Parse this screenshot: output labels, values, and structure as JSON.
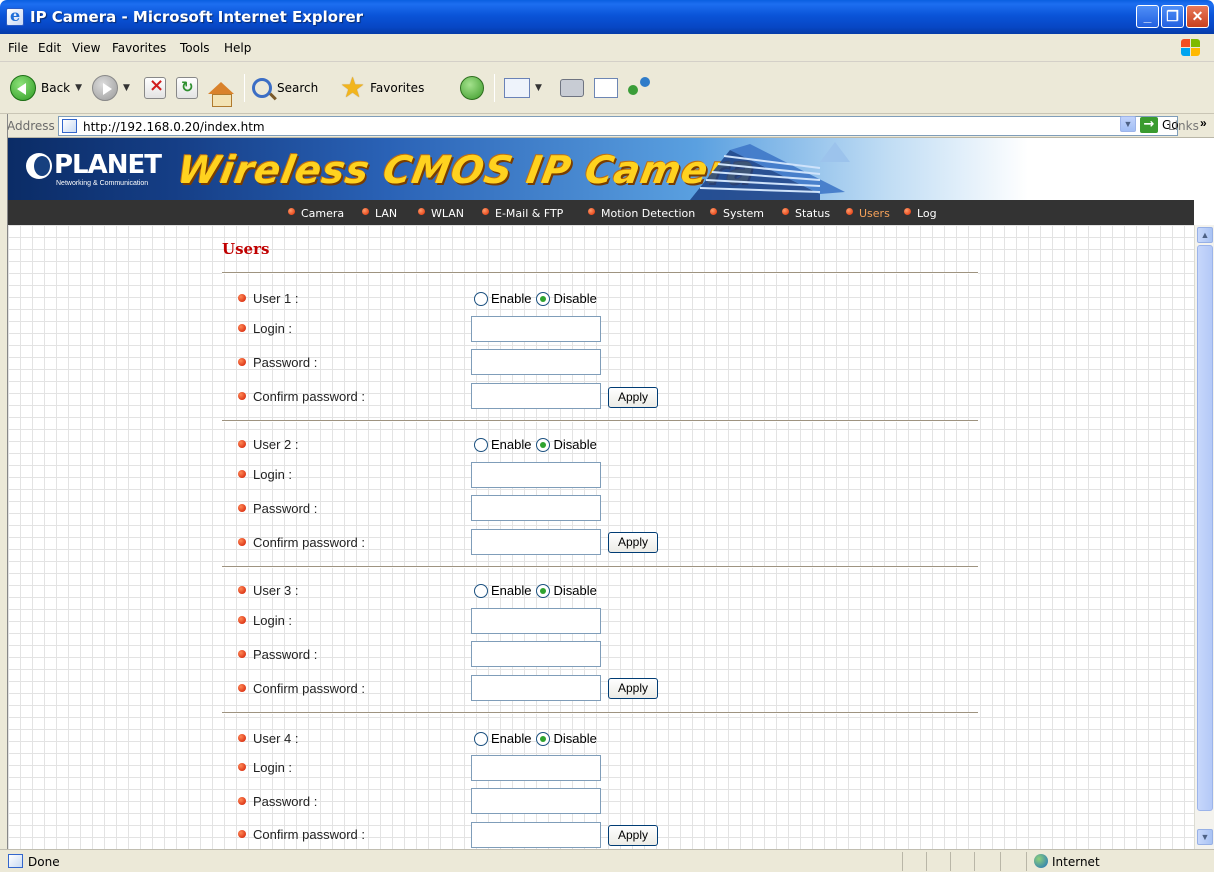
{
  "window": {
    "title": "IP Camera - Microsoft Internet Explorer"
  },
  "menu": [
    "File",
    "Edit",
    "View",
    "Favorites",
    "Tools",
    "Help"
  ],
  "toolbar": {
    "back": "Back",
    "search": "Search",
    "favorites": "Favorites"
  },
  "address": {
    "label": "Address",
    "url": "http://192.168.0.20/index.htm",
    "go": "Go",
    "links": "Links"
  },
  "banner": {
    "brand": "PLANET",
    "tagline": "Networking & Communication",
    "title": "Wireless CMOS IP Camera"
  },
  "nav": [
    {
      "label": "Camera",
      "active": false
    },
    {
      "label": "LAN",
      "active": false
    },
    {
      "label": "WLAN",
      "active": false
    },
    {
      "label": "E-Mail & FTP",
      "active": false
    },
    {
      "label": "Motion Detection",
      "active": false
    },
    {
      "label": "System",
      "active": false
    },
    {
      "label": "Status",
      "active": false
    },
    {
      "label": "Users",
      "active": true
    },
    {
      "label": "Log",
      "active": false
    }
  ],
  "page": {
    "heading": "Users"
  },
  "users": [
    {
      "user_label": "User 1 :",
      "enable": "Enable",
      "disable": "Disable",
      "selected": "Disable",
      "login_label": "Login :",
      "login_value": "",
      "password_label": "Password :",
      "password_value": "",
      "confirm_label": "Confirm password :",
      "confirm_value": "",
      "apply": "Apply"
    },
    {
      "user_label": "User 2 :",
      "enable": "Enable",
      "disable": "Disable",
      "selected": "Disable",
      "login_label": "Login :",
      "login_value": "",
      "password_label": "Password :",
      "password_value": "",
      "confirm_label": "Confirm password :",
      "confirm_value": "",
      "apply": "Apply"
    },
    {
      "user_label": "User 3 :",
      "enable": "Enable",
      "disable": "Disable",
      "selected": "Disable",
      "login_label": "Login :",
      "login_value": "",
      "password_label": "Password :",
      "password_value": "",
      "confirm_label": "Confirm password :",
      "confirm_value": "",
      "apply": "Apply"
    },
    {
      "user_label": "User 4 :",
      "enable": "Enable",
      "disable": "Disable",
      "selected": "Disable",
      "login_label": "Login :",
      "login_value": "",
      "password_label": "Password :",
      "password_value": "",
      "confirm_label": "Confirm password :",
      "confirm_value": "",
      "apply": "Apply"
    }
  ],
  "status": {
    "text": "Done",
    "zone": "Internet"
  },
  "icons": {
    "app": "ie-page-icon",
    "back": "back-arrow-icon",
    "forward": "forward-arrow-icon",
    "stop": "stop-icon",
    "refresh": "refresh-icon",
    "home": "home-icon",
    "search": "search-icon",
    "favorites": "star-icon",
    "history": "history-icon",
    "mail": "mail-icon",
    "print": "print-icon",
    "edit": "edit-icon",
    "messenger": "messenger-icon",
    "go": "go-arrow-icon",
    "zone": "globe-icon"
  },
  "colors": {
    "titlebar": "#0a54d8",
    "heading": "#c00000",
    "nav_bg": "#333333",
    "nav_active": "#f6a25a",
    "banner_title": "#ffd21f"
  }
}
